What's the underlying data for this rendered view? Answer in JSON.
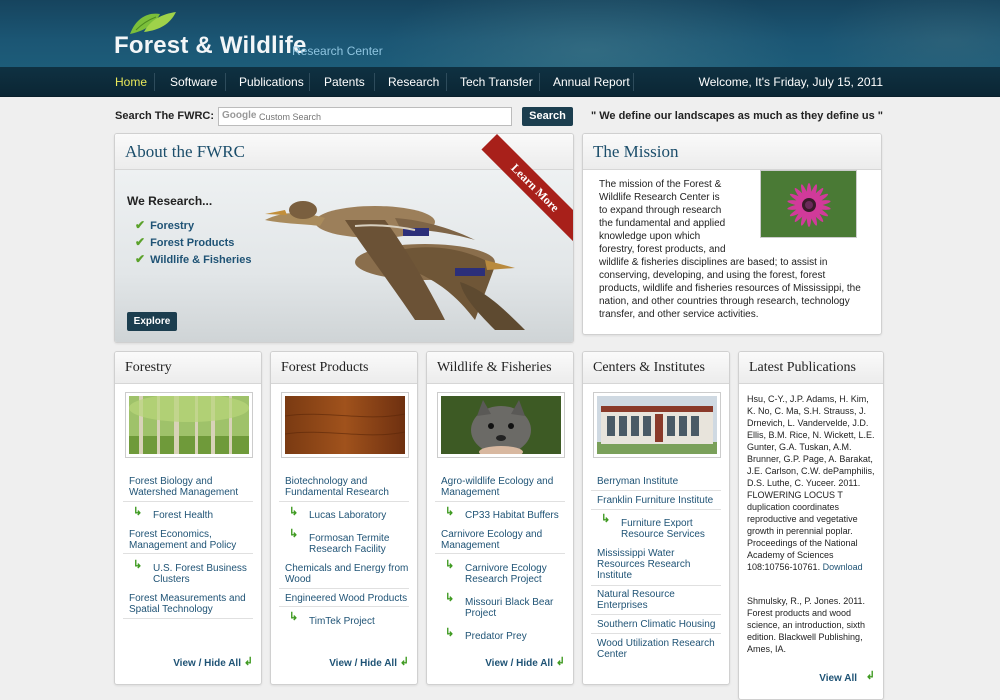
{
  "site": {
    "title": "Forest & Wildlife",
    "subtitle": "Research Center"
  },
  "nav": {
    "items": [
      {
        "label": "Home",
        "active": true
      },
      {
        "label": "Software"
      },
      {
        "label": "Publications"
      },
      {
        "label": "Patents"
      },
      {
        "label": "Research"
      },
      {
        "label": "Tech Transfer"
      },
      {
        "label": "Annual Report"
      }
    ],
    "welcome": "Welcome, It's Friday, July 15, 2011"
  },
  "search": {
    "label": "Search The FWRC:",
    "google_mark": "Google",
    "placeholder": "Custom Search",
    "button": "Search"
  },
  "motto": "\" We define our landscapes as much as they define us \"",
  "about": {
    "title": "About the FWRC",
    "heading": "We Research...",
    "items": [
      "Forestry",
      "Forest Products",
      "Wildlife & Fisheries"
    ],
    "explore": "Explore",
    "ribbon": "Learn More"
  },
  "mission": {
    "title": "The Mission",
    "text": "The mission of the Forest & Wildlife Research Center is to expand through research the fundamental and applied knowledge upon which forestry, forest products, and wildlife & fisheries disciplines are based; to assist in conserving, developing, and using the forest, forest products, wildlife and fisheries resources of Mississippi, the nation, and other countries through research, technology transfer, and other service activities."
  },
  "forestry": {
    "title": "Forestry",
    "links": [
      {
        "label": "Forest Biology and Watershed Management"
      },
      {
        "label": "Forest Health",
        "sub": true
      },
      {
        "label": "Forest Economics, Management and Policy"
      },
      {
        "label": "U.S. Forest Business Clusters",
        "sub": true
      },
      {
        "label": "Forest Measurements and Spatial Technology"
      }
    ],
    "view_all": "View / Hide All"
  },
  "forest_products": {
    "title": "Forest Products",
    "links": [
      {
        "label": "Biotechnology and Fundamental Research"
      },
      {
        "label": "Lucas Laboratory",
        "sub": true
      },
      {
        "label": "Formosan Termite Research Facility",
        "sub": true
      },
      {
        "label": "Chemicals and Energy from Wood"
      },
      {
        "label": "Engineered Wood Products"
      },
      {
        "label": "TimTek Project",
        "sub": true
      }
    ],
    "view_all": "View / Hide All"
  },
  "wildlife": {
    "title": "Wildlife & Fisheries",
    "links": [
      {
        "label": "Agro-wildlife Ecology and Management"
      },
      {
        "label": "CP33 Habitat Buffers",
        "sub": true
      },
      {
        "label": "Carnivore Ecology and Management"
      },
      {
        "label": "Carnivore Ecology Research Project",
        "sub": true
      },
      {
        "label": "Missouri Black Bear Project",
        "sub": true
      },
      {
        "label": "Predator Prey",
        "sub": true
      }
    ],
    "view_all": "View / Hide All"
  },
  "centers": {
    "title": "Centers & Institutes",
    "links": [
      {
        "label": "Berryman Institute"
      },
      {
        "label": "Franklin Furniture Institute"
      },
      {
        "label": "Furniture Export Resource Services",
        "sub": true
      },
      {
        "label": "Mississippi Water Resources Research Institute"
      },
      {
        "label": "Natural Resource Enterprises"
      },
      {
        "label": "Southern Climatic Housing"
      },
      {
        "label": "Wood Utilization Research Center"
      }
    ]
  },
  "publications": {
    "title": "Latest Publications",
    "pub1": "Hsu, C-Y., J.P. Adams, H. Kim, K. No, C. Ma, S.H. Strauss, J. Drnevich, L. Vandervelde, J.D. Ellis, B.M. Rice, N. Wickett, L.E. Gunter, G.A. Tuskan, A.M. Brunner, G.P. Page, A. Barakat, J.E. Carlson, C.W. dePamphilis, D.S. Luthe, C. Yuceer. 2011. FLOWERING LOCUS T duplication coordinates reproductive and vegetative growth in perennial poplar. Proceedings of the National Academy of Sciences 108:10756-10761.",
    "pub1_link": "Download",
    "pub2": "Shmulsky, R., P. Jones. 2011. Forest products and wood science, an introduction, sixth edition. Blackwell Publishing, Ames, IA.",
    "view_all": "View All"
  },
  "colors": {
    "header": "#1b5674",
    "nav": "#0f3142",
    "active_nav": "#e9e85a",
    "link": "#1f5375",
    "accent_green": "#5ba22b",
    "ribbon": "#a8201a"
  }
}
